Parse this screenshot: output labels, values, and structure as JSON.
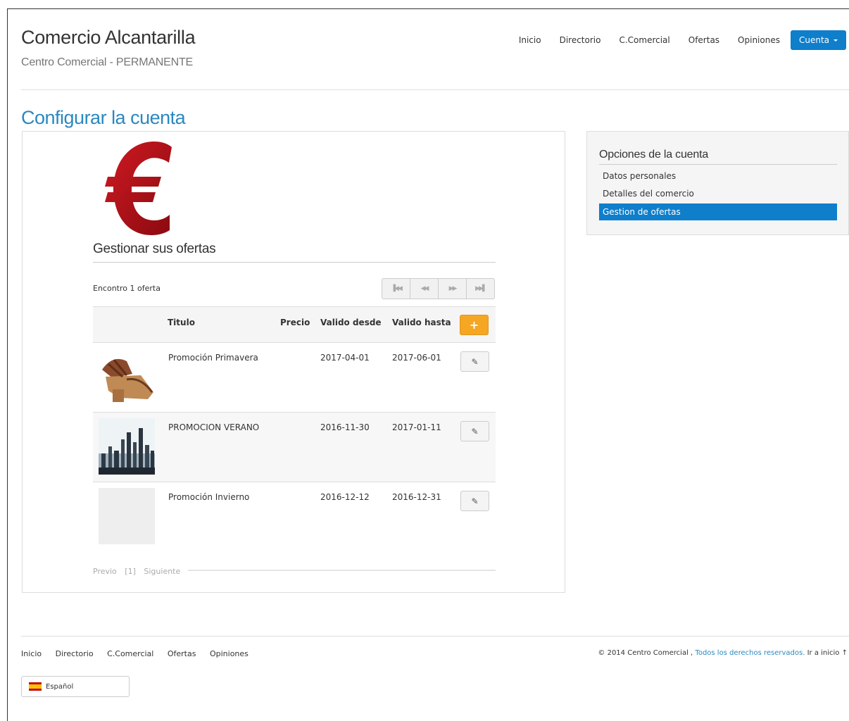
{
  "header": {
    "title": "Comercio Alcantarilla",
    "subtitle": "Centro Comercial - PERMANENTE",
    "nav": [
      "Inicio",
      "Directorio",
      "C.Comercial",
      "Ofertas",
      "Opiniones"
    ],
    "account_label": "Cuenta"
  },
  "page_title": "Configurar la cuenta",
  "main": {
    "section_title": "Gestionar sus ofertas",
    "found_text": "Encontro 1 oferta",
    "pager_icons": [
      "first-page-icon",
      "prev-page-icon",
      "next-page-icon",
      "last-page-icon"
    ],
    "columns": [
      "Titulo",
      "Precio",
      "Valido desde",
      "Valido hasta"
    ],
    "add_label": "+",
    "rows": [
      {
        "title": "Promoción Primavera",
        "price": "",
        "from": "2017-04-01",
        "to": "2017-06-01",
        "image": "sandals-photo"
      },
      {
        "title": "PROMOCION VERANO",
        "price": "",
        "from": "2016-11-30",
        "to": "2017-01-11",
        "image": "city-skyline-photo"
      },
      {
        "title": "Promoción Invierno",
        "price": "",
        "from": "2016-12-12",
        "to": "2016-12-31",
        "image": "placeholder-photo"
      }
    ],
    "bottom_pager": {
      "prev": "Previo",
      "page": "[1]",
      "next": "Siguiente"
    }
  },
  "sidebar": {
    "title": "Opciones de la cuenta",
    "items": [
      {
        "label": "Datos personales",
        "active": false
      },
      {
        "label": "Detalles del comercio",
        "active": false
      },
      {
        "label": "Gestion de ofertas",
        "active": true
      }
    ]
  },
  "footer": {
    "nav": [
      "Inicio",
      "Directorio",
      "C.Comercial",
      "Ofertas",
      "Opiniones"
    ],
    "copyright_prefix": "© 2014 Centro Comercial ,",
    "copyright_link": "Todos los derechos reservados.",
    "go_top": "Ir a inicio ↑",
    "language": "Español"
  },
  "colors": {
    "accent": "#0f7ecb",
    "title_blue": "#2b88c0",
    "add_orange": "#f5a623",
    "euro_red": "#a8101a"
  }
}
